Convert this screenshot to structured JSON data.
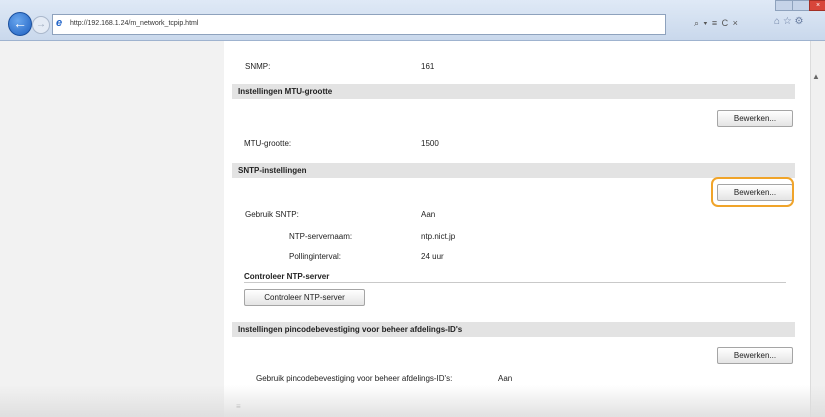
{
  "browser": {
    "url": "http://192.168.1.24/m_network_tcpip.html",
    "address_tools": "⌕ ▾ ≡ C ×",
    "toolbar_icons": "⌂ ☆ ⚙"
  },
  "top_row": {
    "label": "SNMP:",
    "value": "161"
  },
  "mtu": {
    "title": "Instellingen MTU-grootte",
    "edit_label": "Bewerken...",
    "size_label": "MTU-grootte:",
    "size_value": "1500"
  },
  "sntp": {
    "title": "SNTP-instellingen",
    "edit_label": "Bewerken...",
    "use_label": "Gebruik SNTP:",
    "use_value": "Aan",
    "server_label": "NTP-servernaam:",
    "server_value": "ntp.nict.jp",
    "interval_label": "Pollinginterval:",
    "interval_value": "24 uur",
    "check_heading": "Controleer NTP-server",
    "check_button": "Controleer NTP-server"
  },
  "pin": {
    "title": "Instellingen pincodebevestiging voor beheer afdelings-ID's",
    "edit_label": "Bewerken...",
    "row_label": "Gebruik pincodebevestiging voor beheer afdelings-ID's:",
    "row_value": "Aan"
  },
  "footer_mark": "≡",
  "colors": {
    "highlight": "#f0a42a",
    "section_bg": "#e3e3e3"
  }
}
